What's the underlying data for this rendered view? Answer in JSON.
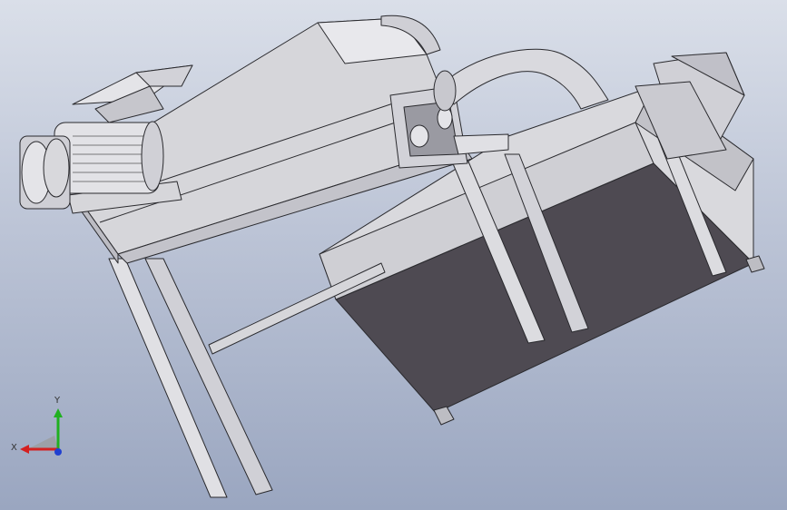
{
  "viewport": {
    "background_top": "#dadfe9",
    "background_bottom": "#9aa6c0"
  },
  "model": {
    "part_fill": "#d6d6da",
    "part_fill_light": "#e6e6ea",
    "part_fill_shade": "#b8b8bf",
    "tank_fill": "#4e4a52",
    "edge_color": "#2a2a2e",
    "motor_fill": "#e2e2e6"
  },
  "triad": {
    "x_label": "X",
    "y_label": "Y",
    "x_color": "#d42020",
    "y_color": "#20b020",
    "z_color": "#2040d0"
  }
}
